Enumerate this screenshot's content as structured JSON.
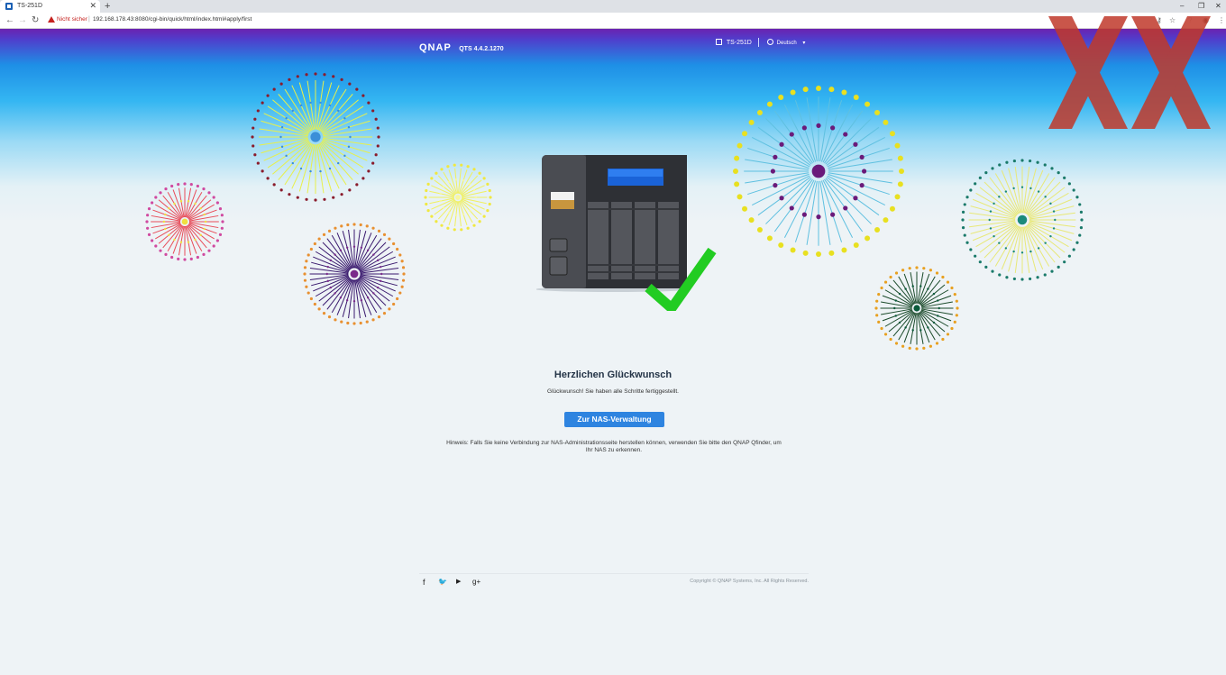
{
  "browser": {
    "tab_title": "TS-251D",
    "tab_close": "✕",
    "new_tab": "+",
    "security_label": "Nicht sicher",
    "url": "192.168.178.43:8080/cgi-bin/quick/html/index.html#apply/first",
    "window_controls": [
      "–",
      "❐",
      "✕"
    ]
  },
  "header": {
    "logo": "QNAP",
    "version": "QTS 4.4.2.1270",
    "device_name": "TS-251D",
    "language": "Deutsch"
  },
  "main": {
    "title": "Herzlichen Glückwunsch",
    "subtitle": "Glückwunsch! Sie haben alle Schritte fertiggestellt.",
    "button_label": "Zur NAS-Verwaltung",
    "hint": "Hinweis: Falls Sie keine Verbindung zur NAS-Administrationsseite herstellen können, verwenden Sie bitte den QNAP Qfinder, um Ihr NAS zu erkennen."
  },
  "footer": {
    "social": [
      "facebook-icon",
      "twitter-icon",
      "youtube-icon",
      "google-plus-icon"
    ],
    "social_glyphs": [
      "f",
      "🐦",
      "▶",
      "g+"
    ],
    "copyright": "Copyright © QNAP Systems, Inc. All Rights Reserved."
  },
  "colors": {
    "accent_button": "#2e84e0",
    "checkmark": "#22cc22",
    "watermark": "#c0392b"
  }
}
